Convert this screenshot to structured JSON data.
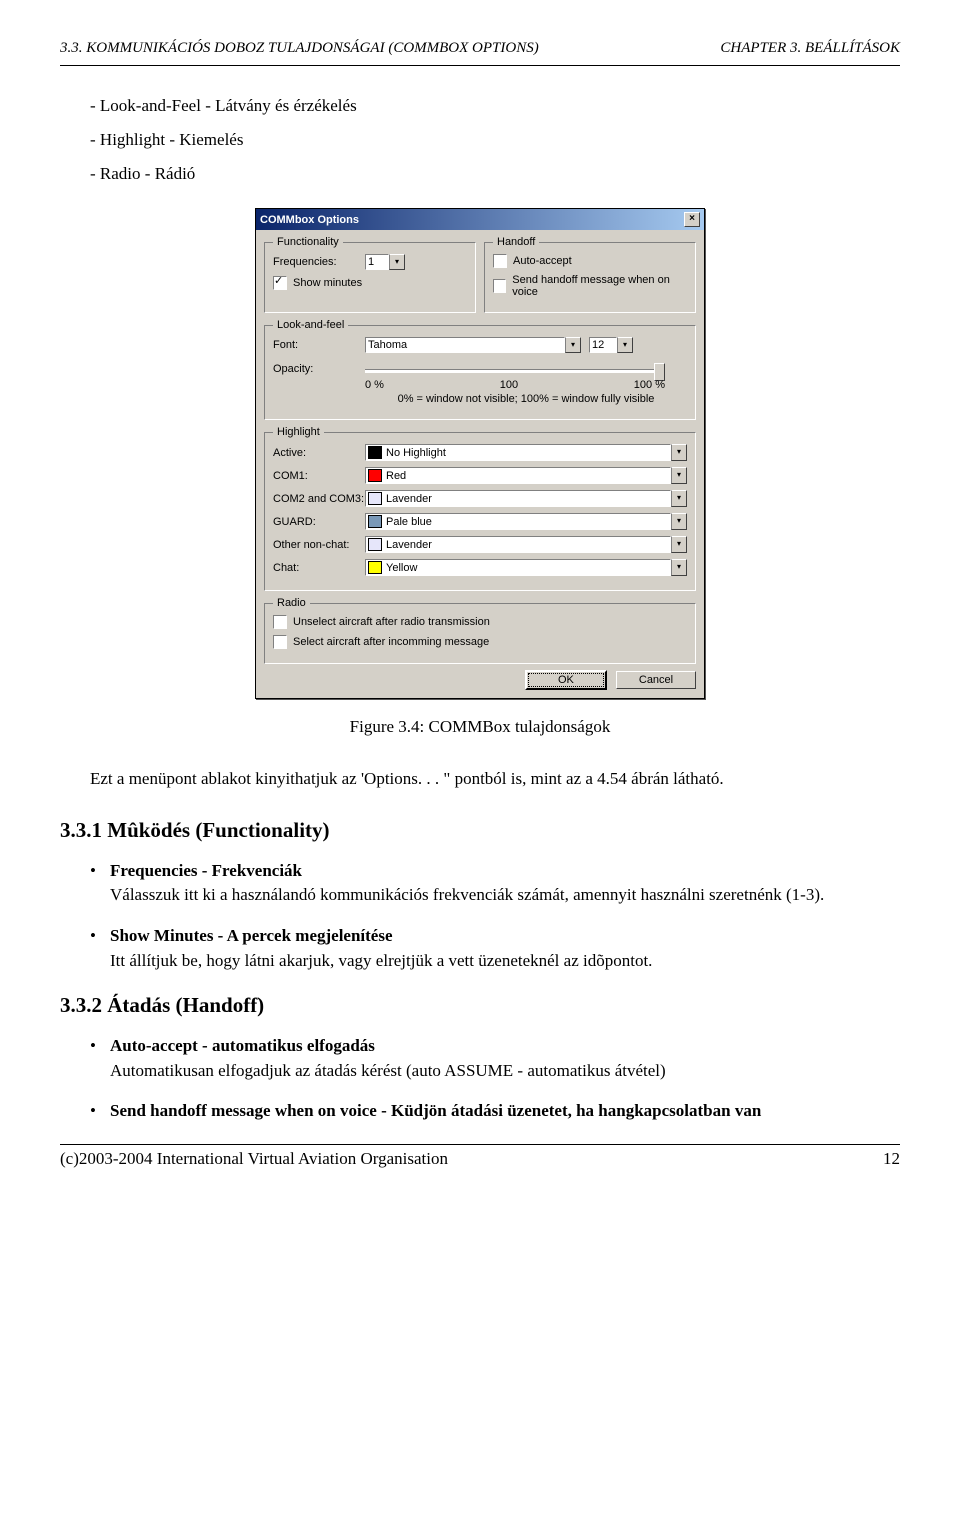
{
  "header": {
    "left": "3.3. KOMMUNIKÁCIÓS DOBOZ TULAJDONSÁGAI (COMMBOX OPTIONS)",
    "right": "CHAPTER 3. BEÁLLÍTÁSOK"
  },
  "intro_items": [
    "Look-and-Feel - Látvány és érzékelés",
    "Highlight - Kiemelés",
    "Radio - Rádió"
  ],
  "dialog": {
    "title": "COMMbox Options",
    "close_label": "×",
    "groups": {
      "functionality": {
        "legend": "Functionality",
        "freq_label": "Frequencies:",
        "freq_value": "1",
        "show_minutes_label": "Show minutes",
        "show_minutes_checked": true
      },
      "handoff": {
        "legend": "Handoff",
        "auto_accept_label": "Auto-accept",
        "auto_accept_checked": false,
        "send_msg_label": "Send handoff message when on voice",
        "send_msg_checked": false
      },
      "lookfeel": {
        "legend": "Look-and-feel",
        "font_label": "Font:",
        "font_value": "Tahoma",
        "font_size": "12",
        "opacity_label": "Opacity:",
        "opacity_0": "0 %",
        "opacity_mid": "100",
        "opacity_100": "100 %",
        "opacity_note": "0% = window not visible; 100% = window fully visible"
      },
      "highlight": {
        "legend": "Highlight",
        "rows": [
          {
            "label": "Active:",
            "value": "No Highlight",
            "swatch": "#000000"
          },
          {
            "label": "COM1:",
            "value": "Red",
            "swatch": "#ff0000"
          },
          {
            "label": "COM2 and COM3:",
            "value": "Lavender",
            "swatch": "#e6e6fa"
          },
          {
            "label": "GUARD:",
            "value": "Pale blue",
            "swatch": "#7a99b8"
          },
          {
            "label": "Other non-chat:",
            "value": "Lavender",
            "swatch": "#e6e6fa"
          },
          {
            "label": "Chat:",
            "value": "Yellow",
            "swatch": "#ffff00"
          }
        ]
      },
      "radio": {
        "legend": "Radio",
        "opt1_label": "Unselect aircraft after radio transmission",
        "opt1_checked": false,
        "opt2_label": "Select aircraft after incomming message",
        "opt2_checked": false
      }
    },
    "ok_label": "OK",
    "cancel_label": "Cancel"
  },
  "caption": "Figure 3.4: COMMBox tulajdonságok",
  "paragraph": "Ezt a menüpont ablakot kinyithatjuk az 'Options. . . \" pontból is, mint az a 4.54 ábrán látható.",
  "section_331": {
    "title": "3.3.1   Mûködés (Functionality)",
    "items": [
      {
        "head": "Frequencies - Frekvenciák",
        "body": "Válasszuk itt ki a használandó kommunikációs frekvenciák számát, amennyit használni szeretnénk (1-3)."
      },
      {
        "head": "Show Minutes - A percek megjelenítése",
        "body": "Itt állítjuk be, hogy látni akarjuk, vagy elrejtjük a vett üzeneteknél az idõpontot."
      }
    ]
  },
  "section_332": {
    "title": "3.3.2   Átadás (Handoff)",
    "items": [
      {
        "head": "Auto-accept - automatikus elfogadás",
        "body": "Automatikusan elfogadjuk az átadás kérést (auto ASSUME - automatikus átvétel)"
      },
      {
        "head": "Send handoff message when on voice - Küdjön átadási üzenetet, ha hangkapcsolatban van",
        "body": ""
      }
    ]
  },
  "footer": {
    "left": "(c)2003-2004 International Virtual Aviation Organisation",
    "right": "12"
  }
}
